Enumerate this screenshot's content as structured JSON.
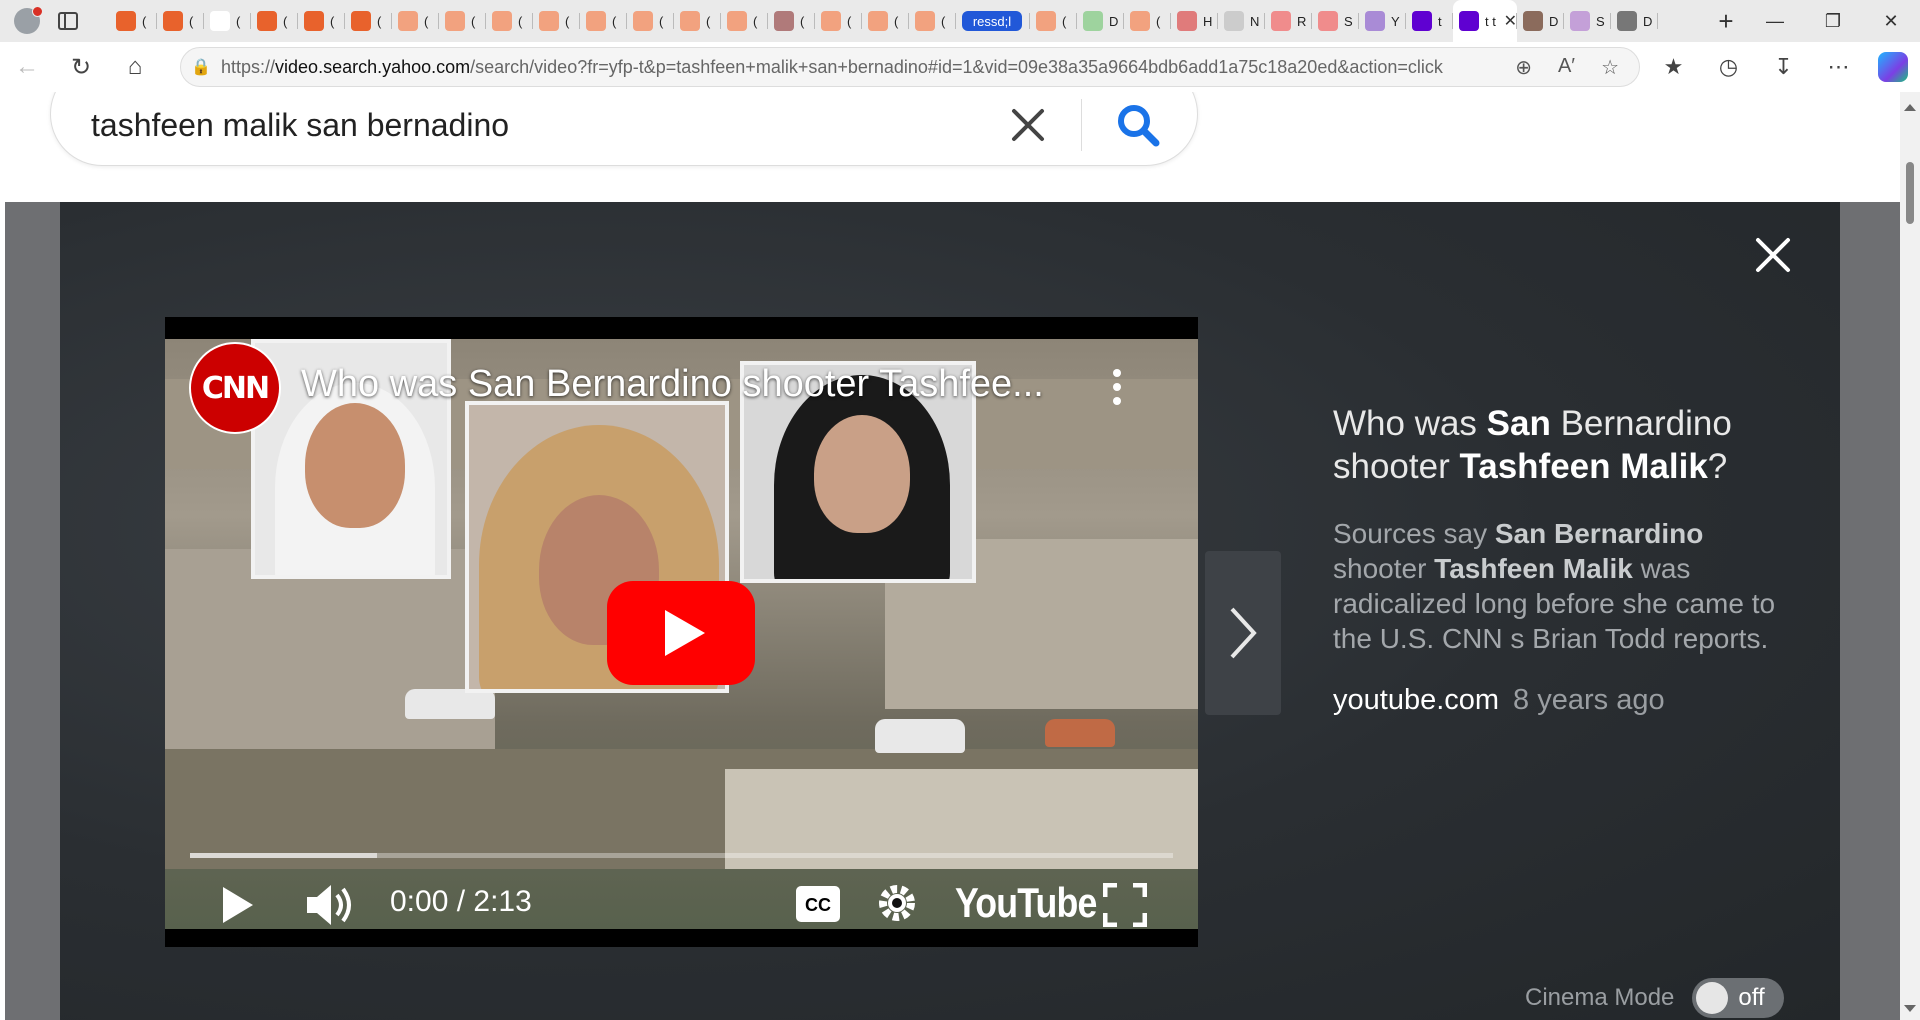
{
  "browser": {
    "tabs": [
      {
        "favicon": "bookmark-orange-icon",
        "label": "(",
        "color": "#e8622c"
      },
      {
        "favicon": "bookmark-orange-icon",
        "label": "(",
        "color": "#e8622c"
      },
      {
        "favicon": "newspaper-icon",
        "label": "(",
        "color": "#ffffff"
      },
      {
        "favicon": "bookmark-orange-icon",
        "label": "(",
        "color": "#e8622c"
      },
      {
        "favicon": "bookmark-orange-icon",
        "label": "(",
        "color": "#e8622c"
      },
      {
        "favicon": "bookmark-orange-icon",
        "label": "(",
        "color": "#e8622c"
      },
      {
        "favicon": "bookmark-faded-icon",
        "label": "(",
        "color": "#f2a27f"
      },
      {
        "favicon": "bookmark-faded-icon",
        "label": "(",
        "color": "#f2a27f"
      },
      {
        "favicon": "bookmark-faded-icon",
        "label": "(",
        "color": "#f2a27f"
      },
      {
        "favicon": "bookmark-faded-icon",
        "label": "(",
        "color": "#f2a27f"
      },
      {
        "favicon": "bookmark-faded-icon",
        "label": "(",
        "color": "#f2a27f"
      },
      {
        "favicon": "bookmark-faded-icon",
        "label": "(",
        "color": "#f2a27f"
      },
      {
        "favicon": "bookmark-faded-icon",
        "label": "(",
        "color": "#f2a27f"
      },
      {
        "favicon": "bookmark-faded-icon",
        "label": "(",
        "color": "#f2a27f"
      },
      {
        "favicon": "grid-page-icon",
        "label": "(",
        "color": "#b07a7a"
      },
      {
        "favicon": "bookmark-faded-icon",
        "label": "(",
        "color": "#f2a27f"
      },
      {
        "favicon": "bookmark-faded-icon",
        "label": "(",
        "color": "#f2a27f"
      },
      {
        "favicon": "bookmark-faded-icon",
        "label": "(",
        "color": "#f2a27f"
      }
    ],
    "highlighted_tab": {
      "label": "ressd;l"
    },
    "tabs_after": [
      {
        "favicon": "bookmark-faded-icon",
        "label": "(",
        "color": "#f2a27f"
      },
      {
        "favicon": "play-green-icon",
        "label": "D",
        "color": "#9ed39e"
      },
      {
        "favicon": "bookmark-faded-icon",
        "label": "(",
        "color": "#f2a27f"
      },
      {
        "favicon": "podcast-icon",
        "label": "H",
        "color": "#e07b7b"
      },
      {
        "favicon": "magnifier-icon",
        "label": "N",
        "color": "#cccccc"
      },
      {
        "favicon": "youtube-icon",
        "label": "R",
        "color": "#f08c8c"
      },
      {
        "favicon": "youtube-icon",
        "label": "S",
        "color": "#f08c8c"
      },
      {
        "favicon": "yahoo-icon",
        "label": "Y",
        "color": "#a98bd6"
      },
      {
        "favicon": "yahoo-icon",
        "label": "t",
        "color": "#5f01d1"
      }
    ],
    "active_tab": {
      "favicon": "yahoo-icon",
      "label": "t t",
      "color": "#5f01d1"
    },
    "tabs_end": [
      {
        "favicon": "photo-icon",
        "label": "D",
        "color": "#8b6b5c"
      },
      {
        "favicon": "mail-icon",
        "label": "S",
        "color": "#c4a0d8"
      },
      {
        "favicon": "stripe-icon",
        "label": "D",
        "color": "#777777"
      }
    ],
    "url_host": "video.search.yahoo.com",
    "url_prefix": "https://",
    "url_rest": "/search/video?fr=yfp-t&p=tashfeen+malik+san+bernadino#id=1&vid=09e38a35a9664bdb6add1a75c18a20ed&action=click"
  },
  "search": {
    "query": "tashfeen malik san bernadino"
  },
  "video": {
    "channel_logo": "CNN",
    "overlay_title": "Who was San Bernardino shooter Tashfee...",
    "time": "0:00 / 2:13",
    "duration": "2:13",
    "position": "0:00",
    "buffered_fraction": 0.19,
    "platform_logo": "YouTube"
  },
  "info": {
    "title_parts": [
      "Who was ",
      "San",
      " Bernardino shooter ",
      "Tashfeen Malik",
      "?"
    ],
    "desc_parts": [
      "Sources say ",
      "San Bernardino",
      " shooter ",
      "Tashfeen Malik",
      " was radicalized long before she came to the U.S. CNN s Brian Todd reports."
    ],
    "source": "youtube.com",
    "age": "8 years ago"
  },
  "cinema_mode": {
    "label": "Cinema Mode",
    "state": "off"
  },
  "colors": {
    "youtube_red": "#ff0000",
    "cnn_red": "#cc0000",
    "search_blue": "#1a73e8",
    "yahoo_purple": "#5f01d1"
  }
}
